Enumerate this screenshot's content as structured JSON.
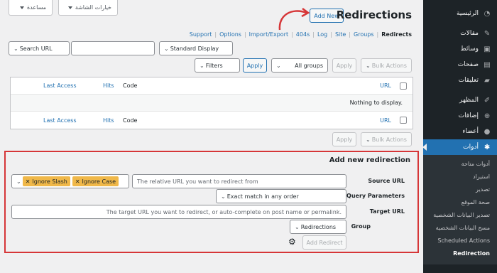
{
  "top_buttons": {
    "screen_options": "خيارات الشاشة",
    "help": "مساعدة"
  },
  "page": {
    "title": "Redirections",
    "add_new": "Add New"
  },
  "subnav": {
    "items": [
      "Support",
      "Options",
      "Import/Export",
      "404s",
      "Log",
      "Site",
      "Groups"
    ],
    "current": "Redirects"
  },
  "search": {
    "search_button": "Search URL",
    "input_value": "",
    "display_select": "Standard Display"
  },
  "filters": {
    "filters_button": "Filters",
    "apply_primary": "Apply",
    "groups_select": "All groups",
    "apply": "Apply",
    "bulk_actions": "Bulk Actions"
  },
  "table": {
    "headers": {
      "last_access": "Last Access",
      "hits": "Hits",
      "code": "Code",
      "url": "URL"
    },
    "empty_message": "Nothing to display."
  },
  "bottom_actions": {
    "apply": "Apply",
    "bulk_actions": "Bulk Actions"
  },
  "add_redirection": {
    "title": "Add new redirection",
    "source_label": "Source URL",
    "source_placeholder": "The relative URL you want to redirect from",
    "tag_ignore_slash": "Ignore Slash",
    "tag_ignore_case": "Ignore Case",
    "query_label": "Query Parameters",
    "query_value": "Exact match in any order",
    "target_label": "Target URL",
    "target_placeholder": "The target URL you want to redirect, or auto-complete on post name or permalink.",
    "group_label": "Group",
    "group_value": "Redirections",
    "add_button": "Add Redirect"
  },
  "sidebar": {
    "items": [
      {
        "label": "الرئيسية",
        "icon": "dashboard-icon"
      },
      {
        "label": "مقالات",
        "icon": "pin-icon"
      },
      {
        "label": "وسائط",
        "icon": "media-icon"
      },
      {
        "label": "صفحات",
        "icon": "page-icon"
      },
      {
        "label": "تعليقات",
        "icon": "comment-icon"
      },
      {
        "label": "المظهر",
        "icon": "brush-icon"
      },
      {
        "label": "إضافات",
        "icon": "plugin-icon"
      },
      {
        "label": "أعضاء",
        "icon": "user-icon"
      },
      {
        "label": "أدوات",
        "icon": "wrench-icon"
      }
    ],
    "submenu": [
      "أدوات متاحة",
      "استيراد",
      "تصدير",
      "صحة الموقع",
      "تصدير البيانات الشخصية",
      "مسح البيانات الشخصية",
      "Scheduled Actions",
      "Redirection"
    ]
  }
}
